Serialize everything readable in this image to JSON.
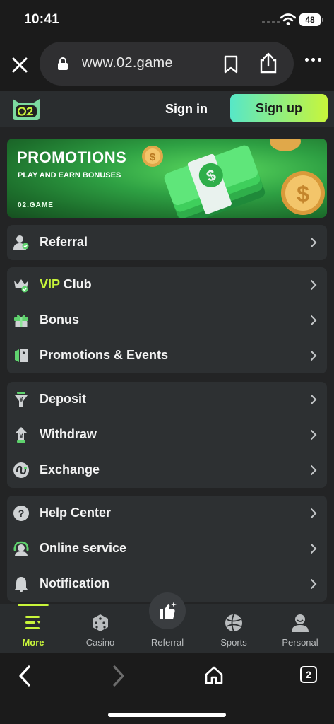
{
  "status_bar": {
    "time": "10:41",
    "battery": "48"
  },
  "browser": {
    "url": "www.02.game",
    "tab_count": "2"
  },
  "header": {
    "signin_label": "Sign in",
    "signup_label": "Sign up"
  },
  "banner": {
    "title": "PROMOTIONS",
    "subtitle": "PLAY AND EARN BONUSES",
    "brand": "02.GAME"
  },
  "menu": {
    "referral": "Referral",
    "vip_prefix": "VIP",
    "vip_suffix": " Club",
    "bonus": "Bonus",
    "promotions": "Promotions & Events",
    "deposit": "Deposit",
    "withdraw": "Withdraw",
    "exchange": "Exchange",
    "help": "Help Center",
    "online_service": "Online service",
    "notification": "Notification"
  },
  "bottom_nav": [
    {
      "label": "More",
      "icon": "more-icon",
      "active": true
    },
    {
      "label": "Casino",
      "icon": "dice-icon",
      "active": false
    },
    {
      "label": "Referral",
      "icon": "thumbs-up-icon",
      "active": false
    },
    {
      "label": "Sports",
      "icon": "ball-icon",
      "active": false
    },
    {
      "label": "Personal",
      "icon": "person-icon",
      "active": false
    }
  ],
  "colors": {
    "accent": "#c8f53a",
    "signup_gradient_start": "#57e7c8",
    "background": "#232425",
    "card": "#2d3032"
  }
}
